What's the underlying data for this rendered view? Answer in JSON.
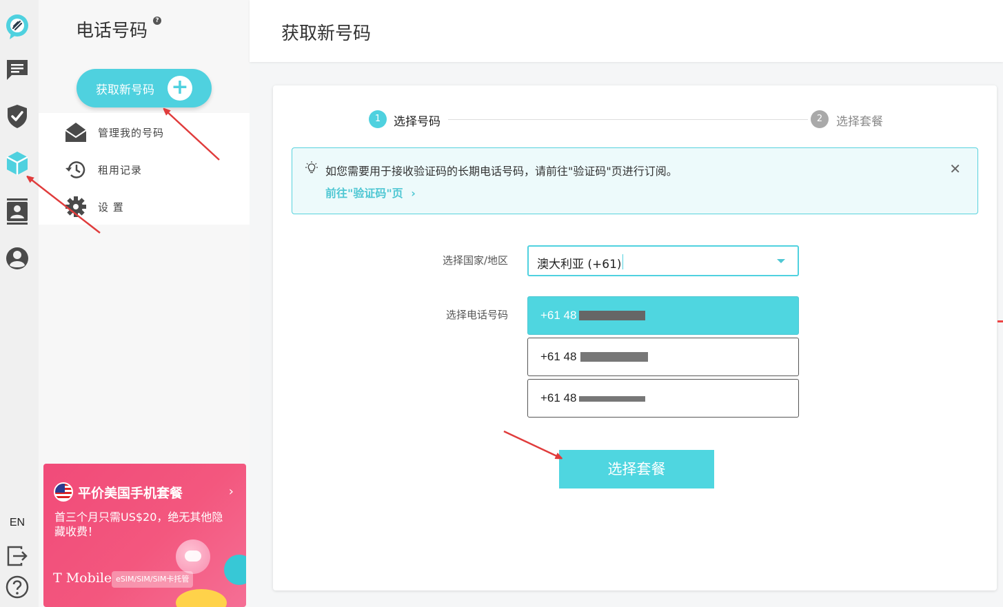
{
  "sidebar": {
    "title": "电话号码",
    "help_icon": "?",
    "get_button_label": "获取新号码",
    "get_button_plus": "+",
    "menu": [
      {
        "label": "管理我的号码",
        "icon": "envelope-icon"
      },
      {
        "label": "租用记录",
        "icon": "history-icon"
      },
      {
        "label": "设 置",
        "icon": "gear-icon"
      }
    ]
  },
  "rail": {
    "icons": [
      "logo-icon",
      "chat-icon",
      "shield-check-icon",
      "cube-icon",
      "contacts-icon",
      "user-icon"
    ],
    "lang": "EN",
    "bottom_icons": [
      "logout-icon",
      "help-icon"
    ]
  },
  "promo": {
    "title": "平价美国手机套餐",
    "chevron": "›",
    "text": "首三个月只需US$20，绝无其他隐藏收费！",
    "brand": "T Mobile",
    "badge": "eSIM/SIM/SIM卡托管"
  },
  "header": {
    "title": "获取新号码"
  },
  "steps": [
    {
      "num": "1",
      "label": "选择号码",
      "active": true
    },
    {
      "num": "2",
      "label": "选择套餐",
      "active": false
    }
  ],
  "notice": {
    "text": "如您需要用于接收验证码的长期电话号码，请前往\"验证码\"页进行订阅。",
    "link": "前往\"验证码\"页",
    "link_chevron": "›",
    "close": "✕"
  },
  "form": {
    "country_label": "选择国家/地区",
    "country_value": "澳大利亚 (+61)",
    "number_label": "选择电话号码",
    "numbers": [
      "+61 48",
      "+61 48",
      "+61 48"
    ],
    "selected_index": 0
  },
  "action": {
    "choose_plan_label": "选择套餐"
  },
  "colors": {
    "accent": "#4fd6e0",
    "promo": "#f14b79",
    "arrow": "#e03c3c"
  }
}
